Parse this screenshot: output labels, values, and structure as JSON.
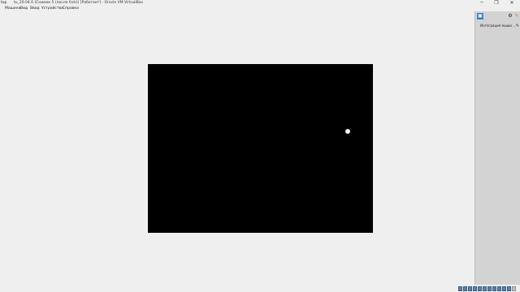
{
  "window": {
    "left_title": "top",
    "title": "tu_20.04.6 (Снимок 5 (после fsck)) [Работает] - Oracle VM VirtualBox",
    "minimize_glyph": "─",
    "restore_glyph": "❐",
    "close_glyph": "✕"
  },
  "menu": {
    "items": [
      "Машина",
      "Вид",
      "Ввод",
      "Устройства",
      "Справка"
    ]
  },
  "side_panel": {
    "row_label": "Интеграция мыши ...",
    "icons": [
      "panel-toggle-icon",
      "settings-icon",
      "edit-icon"
    ],
    "row_icon_glyph": "✎"
  },
  "status_icons": [
    "hdd",
    "optical",
    "audio",
    "network",
    "usb",
    "shared-folders",
    "display",
    "recording",
    "cpu",
    "keyboard",
    "mouse",
    "host-key"
  ],
  "colors": {
    "vm_screen": "#000000",
    "panel_bg": "#d3d3d3",
    "status_icon": "#5d7fa6"
  }
}
